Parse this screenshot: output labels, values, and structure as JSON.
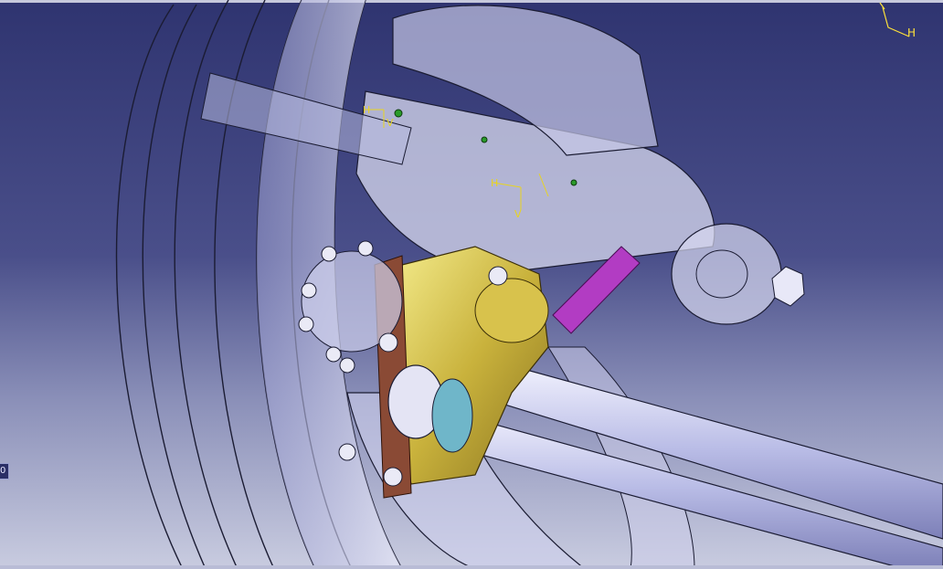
{
  "viewer": {
    "compass": {
      "axis_label": "H"
    },
    "edge_label": "0",
    "annotations": {
      "h1": "H",
      "v1": "V",
      "h2": "H",
      "v2": "V"
    }
  }
}
